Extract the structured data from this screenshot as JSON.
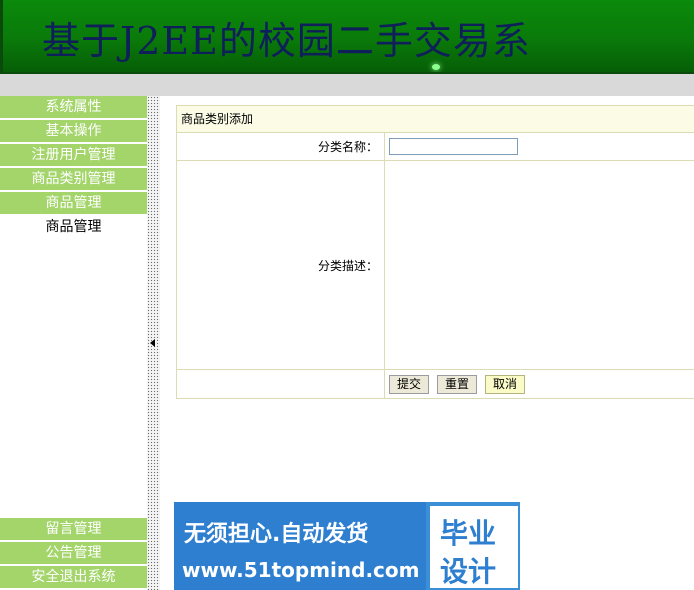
{
  "banner": {
    "title": "基于J2EE的校园二手交易系"
  },
  "sidebar": {
    "items": [
      {
        "label": "系统属性"
      },
      {
        "label": "基本操作"
      },
      {
        "label": "注册用户管理"
      },
      {
        "label": "商品类别管理"
      },
      {
        "label": "商品管理"
      },
      {
        "label": "商品管理"
      }
    ],
    "bottom_items": [
      {
        "label": "留言管理"
      },
      {
        "label": "公告管理"
      },
      {
        "label": "安全退出系统"
      }
    ]
  },
  "form": {
    "title": "商品类别添加",
    "name_label": "分类名称：",
    "name_value": "",
    "desc_label": "分类描述：",
    "desc_value": "",
    "submit_label": "提交",
    "reset_label": "重置",
    "cancel_label": "取消"
  },
  "ad": {
    "line1": "无须担心.自动发货",
    "line2": "www.51topmind.com",
    "word1": "毕业",
    "word2": "设计"
  }
}
